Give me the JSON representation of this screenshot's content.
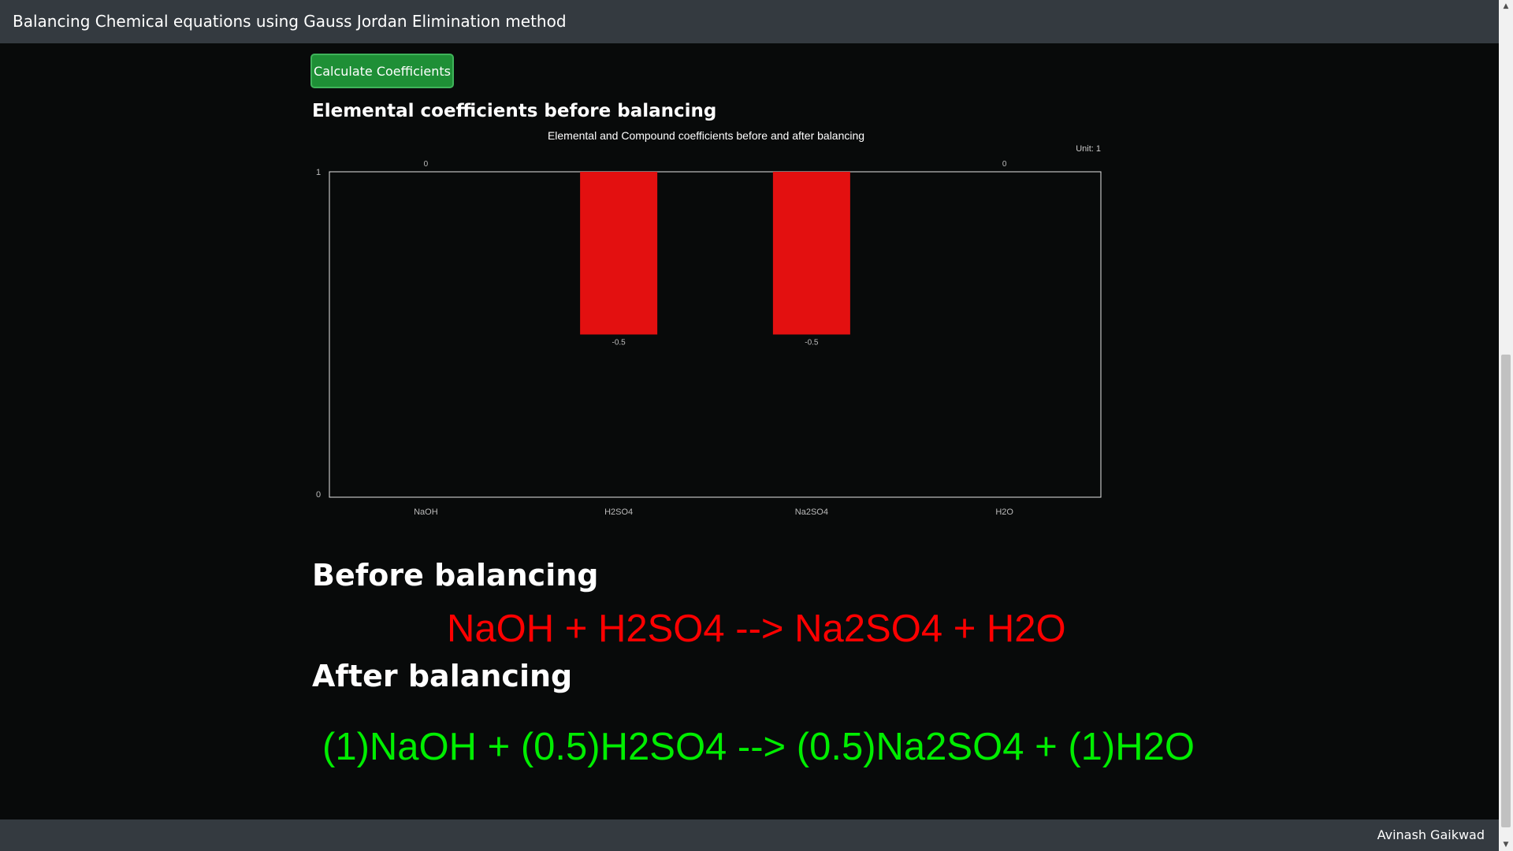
{
  "header": {
    "title": "Balancing Chemical equations using Gauss Jordan Elimination method"
  },
  "actions": {
    "calculate_label": "Calculate Coefficients"
  },
  "chart_section": {
    "heading": "Elemental coefficients before balancing"
  },
  "chart_data": {
    "type": "bar",
    "title": "Elemental and Compound coefficients before and after balancing",
    "unit_label": "Unit: 1",
    "categories": [
      "NaOH",
      "H2SO4",
      "Na2SO4",
      "H2O"
    ],
    "values": [
      0,
      -0.5,
      -0.5,
      0
    ],
    "value_labels": [
      "0",
      "-0.5",
      "-0.5",
      "0"
    ],
    "y_ticks": [
      "1",
      "0"
    ],
    "ylim": [
      0,
      1
    ],
    "bar_color": "#e31010",
    "grid": false,
    "legend": "none"
  },
  "before": {
    "heading": "Before balancing",
    "equation": "NaOH + H2SO4 --> Na2SO4 + H2O",
    "color": "#ff0000"
  },
  "after": {
    "heading": "After balancing",
    "equation": "(1)NaOH + (0.5)H2SO4 --> (0.5)Na2SO4 + (1)H2O",
    "color": "#00ee00"
  },
  "footer": {
    "author": "Avinash Gaikwad"
  },
  "colors": {
    "navbar": "#343a40",
    "background": "#080a0a",
    "button": "#1e8f36"
  }
}
